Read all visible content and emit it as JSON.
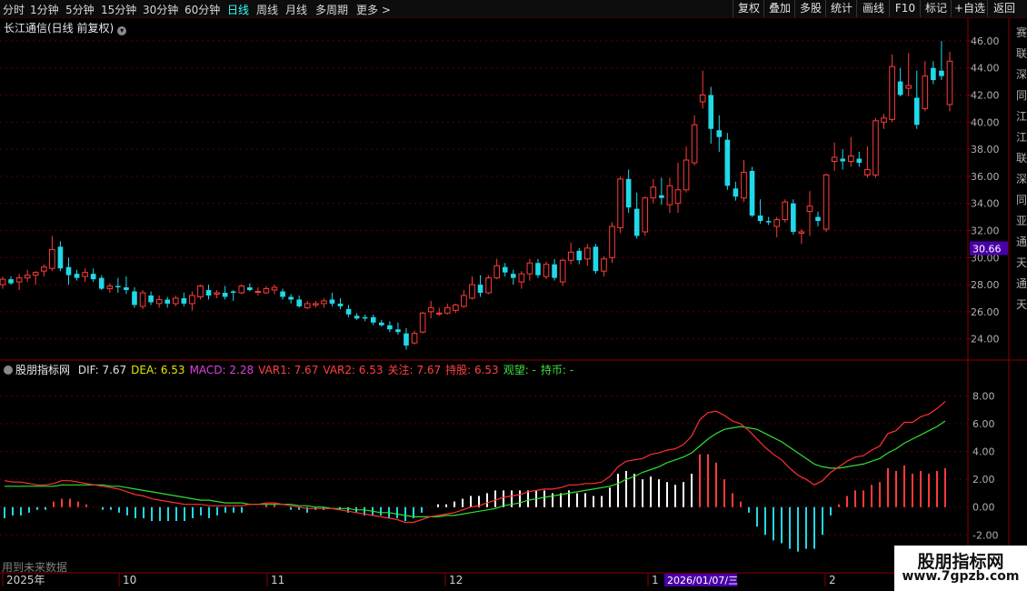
{
  "toolbar": {
    "periods": [
      "分时",
      "1分钟",
      "5分钟",
      "15分钟",
      "30分钟",
      "60分钟",
      "日线",
      "周线",
      "月线",
      "多周期",
      "更多 >"
    ],
    "active": "日线",
    "right_buttons": [
      "复权",
      "叠加",
      "多股",
      "统计",
      "画线",
      "F10",
      "标记",
      "+自选",
      "返回"
    ]
  },
  "stock": {
    "title": "长江通信(日线 前复权)",
    "current_price_tag": "30.66"
  },
  "indicator": {
    "name": "股朋指标网",
    "items": [
      {
        "text": "DIF: 7.67",
        "color": "#e0e0e0"
      },
      {
        "text": "DEA: 6.53",
        "color": "#e6e600"
      },
      {
        "text": "MACD: 2.28",
        "color": "#e040e0"
      },
      {
        "text": "VAR1: 7.67",
        "color": "#ff4040"
      },
      {
        "text": "VAR2: 6.53",
        "color": "#ff4040"
      },
      {
        "text": "关注: 7.67",
        "color": "#ff4040"
      },
      {
        "text": "持股: 6.53",
        "color": "#ff4040"
      },
      {
        "text": "观望: -",
        "color": "#40e040"
      },
      {
        "text": "持币: -",
        "color": "#40e040"
      }
    ]
  },
  "future_text": "用到未来数据",
  "watermark": {
    "title": "股朋指标网",
    "url": "www.7gpzb.com"
  },
  "timeline": {
    "labels": [
      "2025年",
      "10",
      "11",
      "12",
      "1",
      "2"
    ],
    "cursor_label": "2026/01/07/三"
  },
  "right_edge_chars": [
    "赛",
    "联",
    "深",
    "同",
    "江",
    "江",
    "联",
    "深",
    "同",
    "亚",
    "通",
    "天",
    "通",
    "天"
  ],
  "colors": {
    "up": "#ff3b3b",
    "down": "#20d8e8",
    "dif": "#ff3030",
    "dea": "#30e030",
    "axis": "#8b0000",
    "grid": "#5a0000",
    "price_tag_bg": "#4a00a8"
  },
  "chart_data": {
    "type": "candlestick",
    "price_axis": {
      "ticks": [
        24.0,
        26.0,
        28.0,
        30.0,
        32.0,
        34.0,
        36.0,
        38.0,
        40.0,
        42.0,
        44.0,
        46.0
      ],
      "ylim": [
        22.5,
        46.8
      ]
    },
    "macd_axis": {
      "ticks": [
        -2.0,
        0.0,
        2.0,
        4.0,
        6.0,
        8.0
      ],
      "ylim": [
        -4.6,
        9.8
      ]
    },
    "candles": [
      [
        28.0,
        28.6,
        27.7,
        28.4
      ],
      [
        28.4,
        28.6,
        28.0,
        28.1
      ],
      [
        28.2,
        28.8,
        27.6,
        28.5
      ],
      [
        28.5,
        29.1,
        28.2,
        28.7
      ],
      [
        28.7,
        29.0,
        28.0,
        28.9
      ],
      [
        29.0,
        29.5,
        28.6,
        29.3
      ],
      [
        29.2,
        31.6,
        29.0,
        30.6
      ],
      [
        30.8,
        31.2,
        29.0,
        29.2
      ],
      [
        29.3,
        30.0,
        28.0,
        28.7
      ],
      [
        28.8,
        29.1,
        28.3,
        28.5
      ],
      [
        28.6,
        29.2,
        28.2,
        28.9
      ],
      [
        28.8,
        29.2,
        28.2,
        28.4
      ],
      [
        28.5,
        28.7,
        27.6,
        27.7
      ],
      [
        27.7,
        28.1,
        27.4,
        27.9
      ],
      [
        27.9,
        28.5,
        27.4,
        27.8
      ],
      [
        27.8,
        28.6,
        27.3,
        27.6
      ],
      [
        27.5,
        27.8,
        26.3,
        26.5
      ],
      [
        26.4,
        27.6,
        26.2,
        27.4
      ],
      [
        27.2,
        27.5,
        26.5,
        26.7
      ],
      [
        26.6,
        27.2,
        26.3,
        26.9
      ],
      [
        26.9,
        27.1,
        26.3,
        26.6
      ],
      [
        26.6,
        27.2,
        26.4,
        27.0
      ],
      [
        27.0,
        27.4,
        26.4,
        26.6
      ],
      [
        26.6,
        27.5,
        26.1,
        27.2
      ],
      [
        27.1,
        28.0,
        26.9,
        27.9
      ],
      [
        27.6,
        28.0,
        26.9,
        27.2
      ],
      [
        27.3,
        27.6,
        27.0,
        27.4
      ],
      [
        27.4,
        27.9,
        26.9,
        27.1
      ],
      [
        27.5,
        27.6,
        26.8,
        27.4
      ],
      [
        27.4,
        28.0,
        27.3,
        27.9
      ],
      [
        27.8,
        28.1,
        27.5,
        27.6
      ],
      [
        27.5,
        27.8,
        27.2,
        27.5
      ],
      [
        27.4,
        27.9,
        27.3,
        27.7
      ],
      [
        27.6,
        28.0,
        27.3,
        27.8
      ],
      [
        27.5,
        27.7,
        26.9,
        27.1
      ],
      [
        27.1,
        27.3,
        26.6,
        26.9
      ],
      [
        26.9,
        27.2,
        26.3,
        26.4
      ],
      [
        26.3,
        26.8,
        26.2,
        26.6
      ],
      [
        26.5,
        26.8,
        26.3,
        26.6
      ],
      [
        26.6,
        27.0,
        26.3,
        26.8
      ],
      [
        26.9,
        27.4,
        26.4,
        26.6
      ],
      [
        26.6,
        27.0,
        26.2,
        26.4
      ],
      [
        26.2,
        26.5,
        25.6,
        25.8
      ],
      [
        25.7,
        25.9,
        25.4,
        25.5
      ],
      [
        25.6,
        25.8,
        25.3,
        25.5
      ],
      [
        25.6,
        25.8,
        25.0,
        25.2
      ],
      [
        25.2,
        25.4,
        24.9,
        25.0
      ],
      [
        25.0,
        25.3,
        24.5,
        24.7
      ],
      [
        24.7,
        25.2,
        24.3,
        24.5
      ],
      [
        24.4,
        24.8,
        23.2,
        23.5
      ],
      [
        23.7,
        24.6,
        23.6,
        24.4
      ],
      [
        24.5,
        26.0,
        24.4,
        25.9
      ],
      [
        26.0,
        26.8,
        25.5,
        26.3
      ],
      [
        25.9,
        26.3,
        25.7,
        25.9
      ],
      [
        25.9,
        26.6,
        25.8,
        26.3
      ],
      [
        26.1,
        26.6,
        25.9,
        26.5
      ],
      [
        26.4,
        27.6,
        26.3,
        27.2
      ],
      [
        27.0,
        28.6,
        26.9,
        28.0
      ],
      [
        28.0,
        28.7,
        27.1,
        27.4
      ],
      [
        27.4,
        28.7,
        27.3,
        28.5
      ],
      [
        28.5,
        29.9,
        28.4,
        29.4
      ],
      [
        29.3,
        29.6,
        28.6,
        28.9
      ],
      [
        28.8,
        29.1,
        28.0,
        28.5
      ],
      [
        28.2,
        29.0,
        27.7,
        28.8
      ],
      [
        28.8,
        29.9,
        28.3,
        29.6
      ],
      [
        29.6,
        29.9,
        28.5,
        28.7
      ],
      [
        28.6,
        29.7,
        28.4,
        29.5
      ],
      [
        29.5,
        29.9,
        28.3,
        28.5
      ],
      [
        28.2,
        29.9,
        27.9,
        29.8
      ],
      [
        29.8,
        31.1,
        29.5,
        30.4
      ],
      [
        30.5,
        30.7,
        29.5,
        29.8
      ],
      [
        29.9,
        31.0,
        29.4,
        30.7
      ],
      [
        30.8,
        31.0,
        28.8,
        29.0
      ],
      [
        29.0,
        30.1,
        28.6,
        29.9
      ],
      [
        30.0,
        32.6,
        29.6,
        32.3
      ],
      [
        32.2,
        36.0,
        31.8,
        35.8
      ],
      [
        35.8,
        36.5,
        33.3,
        33.7
      ],
      [
        33.6,
        34.8,
        31.4,
        31.6
      ],
      [
        31.9,
        34.5,
        31.6,
        34.4
      ],
      [
        34.4,
        35.8,
        34.0,
        35.2
      ],
      [
        34.6,
        35.9,
        33.9,
        34.4
      ],
      [
        33.9,
        35.9,
        33.3,
        35.3
      ],
      [
        34.0,
        37.0,
        33.3,
        35.0
      ],
      [
        35.0,
        38.2,
        34.8,
        37.2
      ],
      [
        37.0,
        40.5,
        36.8,
        39.8
      ],
      [
        41.5,
        43.8,
        41.0,
        42.0
      ],
      [
        42.0,
        42.6,
        38.4,
        39.5
      ],
      [
        39.4,
        40.5,
        37.8,
        38.9
      ],
      [
        38.7,
        39.2,
        35.0,
        35.3
      ],
      [
        35.1,
        35.6,
        34.2,
        34.5
      ],
      [
        34.4,
        37.2,
        34.1,
        36.3
      ],
      [
        36.4,
        36.7,
        33.0,
        33.1
      ],
      [
        33.1,
        34.3,
        32.5,
        32.7
      ],
      [
        32.7,
        33.0,
        32.4,
        32.6
      ],
      [
        32.3,
        33.0,
        31.5,
        32.8
      ],
      [
        32.8,
        34.3,
        32.6,
        34.1
      ],
      [
        34.0,
        34.3,
        31.7,
        31.9
      ],
      [
        31.8,
        32.1,
        31.0,
        31.9
      ],
      [
        33.4,
        34.9,
        31.6,
        33.8
      ],
      [
        33.0,
        33.4,
        32.3,
        32.7
      ],
      [
        32.1,
        36.2,
        31.9,
        36.1
      ],
      [
        37.1,
        38.5,
        36.4,
        37.4
      ],
      [
        37.3,
        38.0,
        36.5,
        37.1
      ],
      [
        37.1,
        38.9,
        36.7,
        37.5
      ],
      [
        37.3,
        37.8,
        36.7,
        37.0
      ],
      [
        36.1,
        38.2,
        35.9,
        36.5
      ],
      [
        36.1,
        40.3,
        35.9,
        40.1
      ],
      [
        40.0,
        40.6,
        39.5,
        40.3
      ],
      [
        40.2,
        45.0,
        40.0,
        44.1
      ],
      [
        43.0,
        44.0,
        41.9,
        42.0
      ],
      [
        42.5,
        45.1,
        41.9,
        42.7
      ],
      [
        41.8,
        43.8,
        39.5,
        39.8
      ],
      [
        41.0,
        44.5,
        40.8,
        43.4
      ],
      [
        44.0,
        44.5,
        42.8,
        43.1
      ],
      [
        43.8,
        46.0,
        43.1,
        43.4
      ],
      [
        41.3,
        45.2,
        40.8,
        44.5
      ]
    ],
    "dif": [
      1.9,
      1.8,
      1.8,
      1.7,
      1.6,
      1.6,
      1.7,
      1.9,
      1.9,
      1.8,
      1.7,
      1.6,
      1.5,
      1.4,
      1.3,
      1.1,
      0.9,
      0.8,
      0.6,
      0.5,
      0.4,
      0.3,
      0.2,
      0.2,
      0.2,
      0.1,
      0.1,
      0.1,
      0.1,
      0.1,
      0.2,
      0.2,
      0.3,
      0.3,
      0.2,
      0.1,
      0.0,
      -0.1,
      -0.1,
      -0.1,
      -0.1,
      -0.2,
      -0.3,
      -0.4,
      -0.5,
      -0.6,
      -0.7,
      -0.8,
      -0.9,
      -1.1,
      -1.1,
      -0.9,
      -0.7,
      -0.6,
      -0.5,
      -0.4,
      -0.2,
      0.0,
      0.1,
      0.3,
      0.5,
      0.7,
      0.8,
      0.9,
      1.1,
      1.2,
      1.3,
      1.3,
      1.4,
      1.6,
      1.6,
      1.7,
      1.7,
      1.8,
      2.2,
      2.9,
      3.3,
      3.4,
      3.5,
      3.8,
      3.9,
      4.1,
      4.2,
      4.5,
      5.1,
      6.3,
      6.8,
      6.9,
      6.6,
      6.2,
      6.0,
      5.5,
      4.9,
      4.3,
      3.8,
      3.4,
      2.8,
      2.3,
      2.0,
      1.6,
      1.9,
      2.5,
      2.9,
      3.3,
      3.6,
      3.7,
      4.1,
      4.4,
      5.3,
      5.5,
      6.1,
      6.1,
      6.5,
      6.7,
      7.1,
      7.6
    ],
    "dea": [
      1.5,
      1.5,
      1.5,
      1.5,
      1.5,
      1.5,
      1.5,
      1.6,
      1.6,
      1.6,
      1.6,
      1.6,
      1.6,
      1.5,
      1.5,
      1.4,
      1.3,
      1.2,
      1.1,
      1.0,
      0.9,
      0.8,
      0.7,
      0.6,
      0.5,
      0.5,
      0.4,
      0.3,
      0.3,
      0.3,
      0.2,
      0.2,
      0.2,
      0.2,
      0.2,
      0.2,
      0.1,
      0.1,
      0.0,
      0.0,
      -0.1,
      -0.1,
      -0.1,
      -0.2,
      -0.2,
      -0.3,
      -0.4,
      -0.4,
      -0.5,
      -0.6,
      -0.7,
      -0.7,
      -0.7,
      -0.7,
      -0.6,
      -0.6,
      -0.5,
      -0.4,
      -0.3,
      -0.2,
      -0.1,
      0.1,
      0.2,
      0.3,
      0.5,
      0.6,
      0.7,
      0.8,
      0.9,
      1.0,
      1.1,
      1.2,
      1.3,
      1.4,
      1.5,
      1.7,
      2.0,
      2.2,
      2.5,
      2.7,
      2.9,
      3.2,
      3.4,
      3.6,
      3.9,
      4.4,
      4.9,
      5.3,
      5.6,
      5.7,
      5.8,
      5.7,
      5.6,
      5.3,
      5.0,
      4.7,
      4.3,
      3.9,
      3.5,
      3.1,
      2.9,
      2.8,
      2.8,
      2.9,
      3.0,
      3.1,
      3.3,
      3.5,
      3.9,
      4.2,
      4.6,
      4.9,
      5.2,
      5.5,
      5.8,
      6.2
    ],
    "macd": [
      -0.8,
      -0.6,
      -0.6,
      -0.4,
      -0.2,
      -0.2,
      0.4,
      0.6,
      0.6,
      0.4,
      0.2,
      0.0,
      -0.2,
      -0.2,
      -0.4,
      -0.6,
      -0.8,
      -0.8,
      -1.0,
      -1.0,
      -1.0,
      -1.0,
      -1.0,
      -0.8,
      -0.6,
      -0.8,
      -0.6,
      -0.4,
      -0.4,
      -0.4,
      0.0,
      0.0,
      0.2,
      0.2,
      0.0,
      -0.2,
      -0.2,
      -0.4,
      -0.2,
      -0.2,
      0.0,
      -0.2,
      -0.4,
      -0.4,
      -0.6,
      -0.6,
      -0.6,
      -0.8,
      -0.8,
      -1.0,
      -0.8,
      -0.4,
      0.0,
      0.2,
      0.2,
      0.4,
      0.6,
      0.8,
      0.8,
      1.0,
      1.2,
      1.2,
      1.2,
      1.2,
      1.2,
      1.2,
      1.2,
      1.0,
      1.0,
      1.2,
      1.0,
      1.0,
      0.8,
      0.8,
      1.4,
      2.4,
      2.6,
      2.4,
      2.0,
      2.2,
      2.0,
      1.8,
      1.6,
      1.8,
      2.4,
      3.8,
      3.8,
      3.2,
      2.0,
      1.0,
      0.4,
      -0.4,
      -1.4,
      -2.0,
      -2.4,
      -2.6,
      -3.0,
      -3.2,
      -3.0,
      -3.0,
      -2.0,
      -0.6,
      0.2,
      0.8,
      1.2,
      1.2,
      1.6,
      1.8,
      2.8,
      2.6,
      3.0,
      2.4,
      2.6,
      2.4,
      2.6,
      2.8
    ]
  }
}
